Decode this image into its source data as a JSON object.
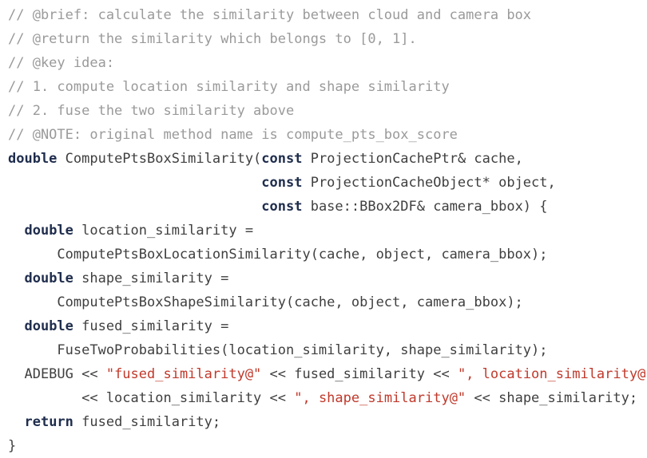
{
  "editor": {
    "language": "C++",
    "background_color": "#ffffff",
    "font_size_px": 17,
    "line_height_px": 30,
    "colors": {
      "comment": "#9a9a9a",
      "keyword": "#1f2d4d",
      "string": "#c0392b",
      "plain": "#3f3f3f"
    }
  },
  "code": {
    "lines": [
      {
        "index": 1,
        "text": "// @brief: calculate the similarity between cloud and camera box",
        "tokens": [
          {
            "kind": "comment",
            "text": "// @brief: calculate the similarity between cloud and camera box"
          }
        ]
      },
      {
        "index": 2,
        "text": "// @return the similarity which belongs to [0, 1].",
        "tokens": [
          {
            "kind": "comment",
            "text": "// @return the similarity which belongs to [0, 1]."
          }
        ]
      },
      {
        "index": 3,
        "text": "// @key idea:",
        "tokens": [
          {
            "kind": "comment",
            "text": "// @key idea:"
          }
        ]
      },
      {
        "index": 4,
        "text": "// 1. compute location similarity and shape similarity",
        "tokens": [
          {
            "kind": "comment",
            "text": "// 1. compute location similarity and shape similarity"
          }
        ]
      },
      {
        "index": 5,
        "text": "// 2. fuse the two similarity above",
        "tokens": [
          {
            "kind": "comment",
            "text": "// 2. fuse the two similarity above"
          }
        ]
      },
      {
        "index": 6,
        "text": "// @NOTE: original method name is compute_pts_box_score",
        "tokens": [
          {
            "kind": "comment",
            "text": "// @NOTE: original method name is compute_pts_box_score"
          }
        ]
      },
      {
        "index": 7,
        "text": "double ComputePtsBoxSimilarity(const ProjectionCachePtr& cache,",
        "tokens": [
          {
            "kind": "keyword",
            "text": "double"
          },
          {
            "kind": "plain",
            "text": " ComputePtsBoxSimilarity("
          },
          {
            "kind": "keyword",
            "text": "const"
          },
          {
            "kind": "plain",
            "text": " ProjectionCachePtr& cache,"
          }
        ]
      },
      {
        "index": 8,
        "text": "                               const ProjectionCacheObject* object,",
        "tokens": [
          {
            "kind": "plain",
            "text": "                               "
          },
          {
            "kind": "keyword",
            "text": "const"
          },
          {
            "kind": "plain",
            "text": " ProjectionCacheObject* object,"
          }
        ]
      },
      {
        "index": 9,
        "text": "                               const base::BBox2DF& camera_bbox) {",
        "tokens": [
          {
            "kind": "plain",
            "text": "                               "
          },
          {
            "kind": "keyword",
            "text": "const"
          },
          {
            "kind": "plain",
            "text": " base::BBox2DF& camera_bbox) {"
          }
        ]
      },
      {
        "index": 10,
        "text": "  double location_similarity =",
        "tokens": [
          {
            "kind": "plain",
            "text": "  "
          },
          {
            "kind": "keyword",
            "text": "double"
          },
          {
            "kind": "plain",
            "text": " location_similarity ="
          }
        ]
      },
      {
        "index": 11,
        "text": "      ComputePtsBoxLocationSimilarity(cache, object, camera_bbox);",
        "tokens": [
          {
            "kind": "plain",
            "text": "      ComputePtsBoxLocationSimilarity(cache, object, camera_bbox);"
          }
        ]
      },
      {
        "index": 12,
        "text": "  double shape_similarity =",
        "tokens": [
          {
            "kind": "plain",
            "text": "  "
          },
          {
            "kind": "keyword",
            "text": "double"
          },
          {
            "kind": "plain",
            "text": " shape_similarity ="
          }
        ]
      },
      {
        "index": 13,
        "text": "      ComputePtsBoxShapeSimilarity(cache, object, camera_bbox);",
        "tokens": [
          {
            "kind": "plain",
            "text": "      ComputePtsBoxShapeSimilarity(cache, object, camera_bbox);"
          }
        ]
      },
      {
        "index": 14,
        "text": "  double fused_similarity =",
        "tokens": [
          {
            "kind": "plain",
            "text": "  "
          },
          {
            "kind": "keyword",
            "text": "double"
          },
          {
            "kind": "plain",
            "text": " fused_similarity ="
          }
        ]
      },
      {
        "index": 15,
        "text": "      FuseTwoProbabilities(location_similarity, shape_similarity);",
        "tokens": [
          {
            "kind": "plain",
            "text": "      FuseTwoProbabilities(location_similarity, shape_similarity);"
          }
        ]
      },
      {
        "index": 16,
        "text": "  ADEBUG << \"fused_similarity@\" << fused_similarity << \", location_similarity@\"",
        "tokens": [
          {
            "kind": "plain",
            "text": "  ADEBUG << "
          },
          {
            "kind": "string",
            "text": "\"fused_similarity@\""
          },
          {
            "kind": "plain",
            "text": " << fused_similarity << "
          },
          {
            "kind": "string",
            "text": "\", location_similarity@\""
          }
        ]
      },
      {
        "index": 17,
        "text": "         << location_similarity << \", shape_similarity@\" << shape_similarity;",
        "tokens": [
          {
            "kind": "plain",
            "text": "         << location_similarity << "
          },
          {
            "kind": "string",
            "text": "\", shape_similarity@\""
          },
          {
            "kind": "plain",
            "text": " << shape_similarity;"
          }
        ]
      },
      {
        "index": 18,
        "text": "  return fused_similarity;",
        "tokens": [
          {
            "kind": "plain",
            "text": "  "
          },
          {
            "kind": "keyword",
            "text": "return"
          },
          {
            "kind": "plain",
            "text": " fused_similarity;"
          }
        ]
      },
      {
        "index": 19,
        "text": "}",
        "tokens": [
          {
            "kind": "plain",
            "text": "}"
          }
        ]
      }
    ]
  }
}
